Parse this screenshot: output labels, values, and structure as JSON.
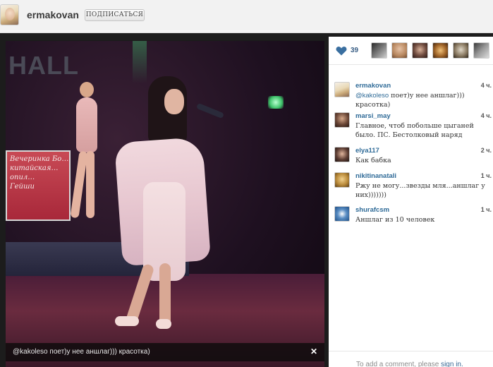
{
  "header": {
    "username": "ermakovan",
    "follow_label": "ПОДПИСАТЬСЯ"
  },
  "photo": {
    "hall_text": "HALL",
    "banner_text": "Вечеринка Бо…\nкитайская…\nопил…\nГейши",
    "caption": "@kakoleso поет)у нее аншлаг))) красотка)",
    "close_label": "✕"
  },
  "likes": {
    "count": "39",
    "icon": "heart-icon",
    "color": "#3a6fa0"
  },
  "comments": [
    {
      "user": "ermakovan",
      "time": "4 ч.",
      "mention": "@kakoleso",
      "text": " поет)у нее аншлаг))) красотка)"
    },
    {
      "user": "marsi_may",
      "time": "4 ч.",
      "mention": "",
      "text": "Главное, чтоб побольше цыганей было. ПС. Бестолковый наряд"
    },
    {
      "user": "elya117",
      "time": "2 ч.",
      "mention": "",
      "text": "Как бабка"
    },
    {
      "user": "nikitinanatali",
      "time": "1 ч.",
      "mention": "",
      "text": "Ржу не могу...звезды мля...аншлаг у них)))))))"
    },
    {
      "user": "shurafcsm",
      "time": "1 ч.",
      "mention": "",
      "text": "Аншлаг из 10 человек"
    }
  ],
  "footer": {
    "text": "To add a comment, please ",
    "link": "sign in."
  }
}
